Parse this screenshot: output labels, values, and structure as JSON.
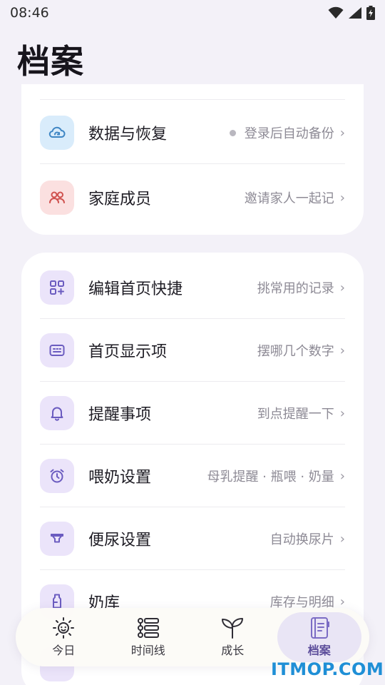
{
  "status_bar": {
    "time": "08:46"
  },
  "header": {
    "title": "档案"
  },
  "card1": {
    "rows": [
      {
        "label": "数据与恢复",
        "hint": "登录后自动备份",
        "icon": "cloud-sync-icon"
      },
      {
        "label": "家庭成员",
        "hint": "邀请家人一起记",
        "icon": "family-members-icon"
      }
    ]
  },
  "card2": {
    "rows": [
      {
        "label": "编辑首页快捷",
        "hint": "挑常用的记录",
        "icon": "grid-add-icon"
      },
      {
        "label": "首页显示项",
        "hint": "摆哪几个数字",
        "icon": "display-panel-icon"
      },
      {
        "label": "提醒事项",
        "hint": "到点提醒一下",
        "icon": "bell-icon"
      },
      {
        "label": "喂奶设置",
        "hint": "母乳提醒 · 瓶喂 · 奶量",
        "icon": "alarm-clock-icon"
      },
      {
        "label": "便尿设置",
        "hint": "自动换尿片",
        "icon": "funnel-icon"
      },
      {
        "label": "奶库",
        "hint": "库存与明细",
        "icon": "milk-bottle-icon"
      }
    ]
  },
  "chevron": "›",
  "bottom_nav": {
    "items": [
      {
        "label": "今日",
        "icon": "sun-icon"
      },
      {
        "label": "时间线",
        "icon": "timeline-icon"
      },
      {
        "label": "成长",
        "icon": "sprout-icon"
      },
      {
        "label": "档案",
        "icon": "notebook-icon",
        "active": true
      }
    ]
  },
  "watermark": "ITMOP.COM",
  "colors": {
    "background": "#f3f1f8",
    "card": "#ffffff",
    "accent": "#7b6cc4",
    "blue_tile": "#d9ecfb",
    "red_tile": "#fbe0e0",
    "purple_tile": "#ebe4fa"
  }
}
